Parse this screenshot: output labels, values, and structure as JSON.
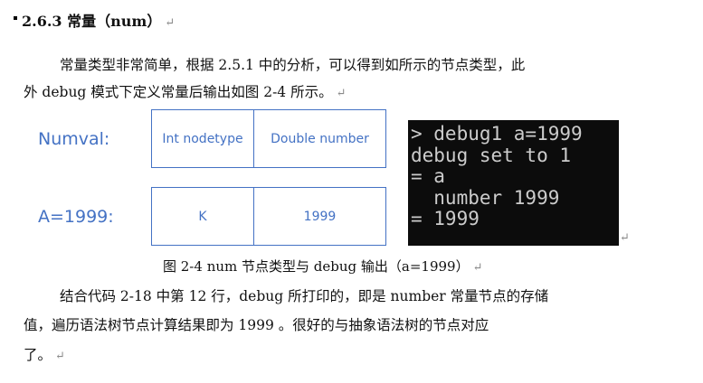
{
  "heading": {
    "number": "2.6.3",
    "title": "常量（num）",
    "return_mark": "↵"
  },
  "paragraph1": {
    "line1": "常量类型非常简单，根据 2.5.1 中的分析，可以得到如所示的节点类型，此",
    "line2": "外 debug 模式下定义常量后输出如图  2-4 所示。",
    "return_mark": "↵"
  },
  "diagram": {
    "label_top": "Numval:",
    "label_bottom": "A=1999:",
    "box_top_left": "Int nodetype",
    "box_top_right": "Double number",
    "box_bottom_left": "K",
    "box_bottom_right": "1999",
    "border_color": "#4472c4",
    "text_color": "#4472c4"
  },
  "terminal": {
    "lines": [
      "> debug1 a=1999",
      "debug set to 1",
      "= a",
      "  number 1999",
      "= 1999"
    ],
    "background": "#0c0c0c",
    "text_color": "#cccccc",
    "return_mark": "↵"
  },
  "caption": {
    "text": "图  2-4    num 节点类型与 debug 输出（a=1999）",
    "return_mark": "↵"
  },
  "paragraph2": {
    "line1": "结合代码  2-18 中第 12 行，debug 所打印的，即是 number 常量节点的存储",
    "line2": "值，遍历语法树节点计算结果即为 1999  。很好的与抽象语法树的节点对应",
    "line3": "了。",
    "return_mark": "↵"
  }
}
